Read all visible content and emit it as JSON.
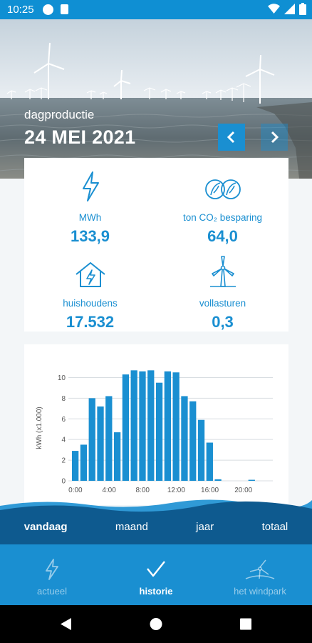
{
  "status": {
    "time": "10:25"
  },
  "header": {
    "date_label": "dagproductie",
    "date_value": "24 MEI 2021"
  },
  "stats": [
    {
      "icon": "lightning-icon",
      "label": "MWh",
      "value": "133,9"
    },
    {
      "icon": "leaves-icon",
      "label": "ton CO₂ besparing",
      "value": "64,0"
    },
    {
      "icon": "house-lightning-icon",
      "label": "huishoudens",
      "value": "17.532"
    },
    {
      "icon": "wind-turbine-icon",
      "label": "vollasturen",
      "value": "0,3"
    }
  ],
  "chart_data": {
    "type": "bar",
    "ylabel": "kWh (x1.000)",
    "xlabel": "",
    "ylim": [
      0,
      11
    ],
    "yticks": [
      "0",
      "2",
      "4",
      "6",
      "8",
      "10"
    ],
    "xticks": [
      "0:00",
      "4:00",
      "8:00",
      "12:00",
      "16:00",
      "20:00"
    ],
    "x": [
      "0:00",
      "1:00",
      "2:00",
      "3:00",
      "4:00",
      "5:00",
      "6:00",
      "7:00",
      "8:00",
      "9:00",
      "10:00",
      "11:00",
      "12:00",
      "13:00",
      "14:00",
      "15:00",
      "16:00",
      "17:00",
      "18:00",
      "19:00",
      "20:00",
      "21:00",
      "22:00",
      "23:00"
    ],
    "values": [
      2.9,
      3.5,
      8.0,
      7.2,
      8.2,
      4.7,
      10.3,
      10.7,
      10.6,
      10.7,
      9.5,
      10.6,
      10.5,
      8.2,
      7.7,
      5.9,
      3.7,
      0.15,
      0,
      0,
      0,
      0.1,
      0,
      0
    ],
    "grid": true,
    "color": "#1a8fd1"
  },
  "periods": [
    "vandaag",
    "maand",
    "jaar",
    "totaal"
  ],
  "active_period": "vandaag",
  "bottom_nav": [
    {
      "icon": "lightning-icon",
      "label": "actueel"
    },
    {
      "icon": "checkmark-icon",
      "label": "historie"
    },
    {
      "icon": "windpark-icon",
      "label": "het windpark"
    }
  ],
  "colors": {
    "accent": "#1a8fd1",
    "status_bar": "#0f8fd3",
    "wave_dark": "#0e5a8f"
  }
}
